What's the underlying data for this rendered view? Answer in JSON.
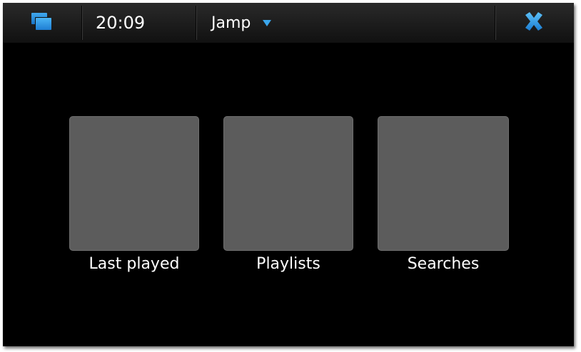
{
  "statusbar": {
    "clock": "20:09",
    "app_title": "Jamp",
    "task_switcher_icon": "task-switcher-icon",
    "menu_arrow_icon": "chevron-down-icon",
    "close_icon": "close-icon",
    "accent_color": "#3aa6ec"
  },
  "main": {
    "tiles": [
      {
        "label": "Last played"
      },
      {
        "label": "Playlists"
      },
      {
        "label": "Searches"
      }
    ]
  },
  "colors": {
    "background": "#000000",
    "tile": "#5c5c5c",
    "text": "#ffffff"
  }
}
